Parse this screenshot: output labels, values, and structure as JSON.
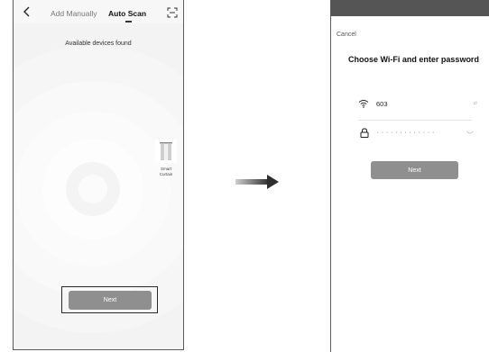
{
  "left_screen": {
    "tabs": [
      {
        "label": "Add Manually",
        "active": false
      },
      {
        "label": "Auto Scan",
        "active": true
      }
    ],
    "found_text": "Available devices found",
    "device": {
      "name_line1": "Smart",
      "name_line2": "Curtain"
    },
    "next_label": "Next",
    "icons": [
      "chevron-left-icon",
      "scan-icon",
      "curtain-icon"
    ]
  },
  "right_screen": {
    "cancel_label": "Cancel",
    "title": "Choose Wi-Fi and enter password",
    "wifi": {
      "ssid": "603",
      "switch_hint": "⇄"
    },
    "password_masked": "·············",
    "next_label": "Next",
    "icons": [
      "wifi-icon",
      "lock-icon",
      "eye-icon"
    ]
  },
  "colors": {
    "button_gray": "#8f8f8f",
    "phone_background": "#f3f3f3",
    "arrow": "#555555"
  }
}
